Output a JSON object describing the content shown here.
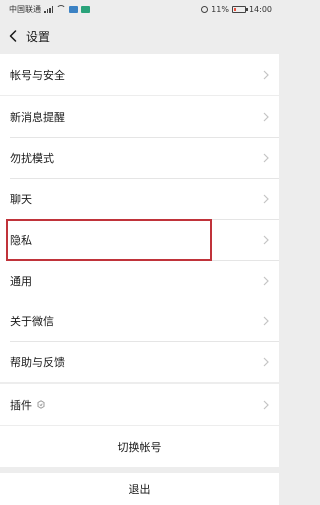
{
  "status_bar": {
    "carrier": "中国联通",
    "battery_percent": "11%",
    "time": "14:00"
  },
  "header": {
    "title": "设置"
  },
  "groups": [
    {
      "items": [
        {
          "label": "帐号与安全"
        }
      ]
    },
    {
      "items": [
        {
          "label": "新消息提醒"
        },
        {
          "label": "勿扰模式"
        },
        {
          "label": "聊天"
        },
        {
          "label": "隐私"
        },
        {
          "label": "通用"
        }
      ]
    },
    {
      "items": [
        {
          "label": "关于微信"
        },
        {
          "label": "帮助与反馈"
        }
      ]
    },
    {
      "items": [
        {
          "label": "插件",
          "icon": "plugin-icon"
        }
      ]
    }
  ],
  "actions": {
    "switch_account": "切换帐号",
    "logout": "退出"
  },
  "highlight": {
    "target": "通用",
    "color": "#c0333a"
  }
}
